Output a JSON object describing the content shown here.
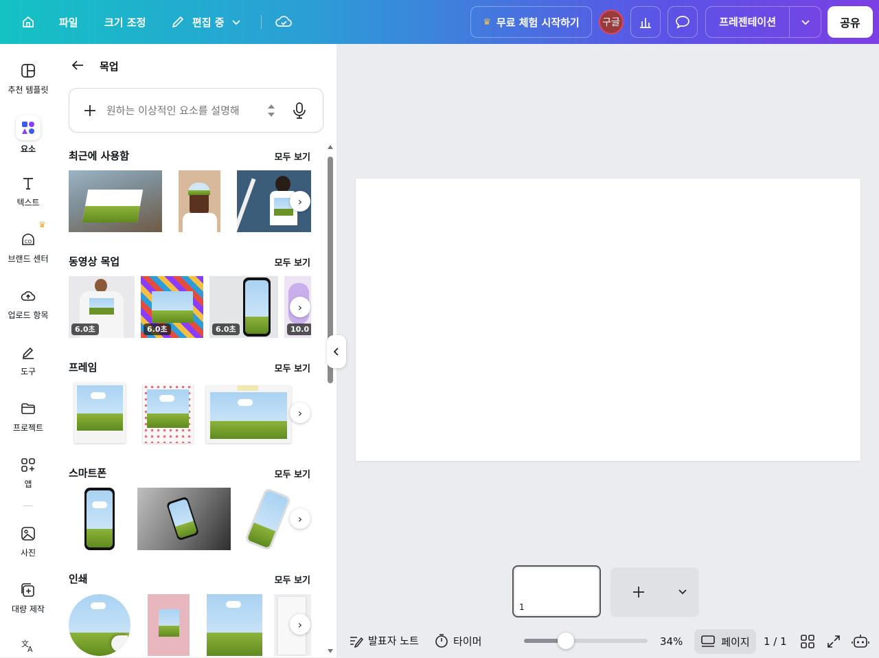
{
  "topbar": {
    "file": "파일",
    "resize": "크기 조정",
    "editing": "편집 중",
    "trial": "무료 체험 시작하기",
    "avatar": "구글",
    "presentation": "프레젠테이션",
    "share": "공유"
  },
  "rail": {
    "items": [
      {
        "label": "추천 템플릿"
      },
      {
        "label": "요소"
      },
      {
        "label": "텍스트"
      },
      {
        "label": "브랜드 센터"
      },
      {
        "label": "업로드 항목"
      },
      {
        "label": "도구"
      },
      {
        "label": "프로젝트"
      },
      {
        "label": "앱"
      },
      {
        "label": "사진"
      },
      {
        "label": "대량 제작"
      }
    ]
  },
  "panel": {
    "title": "목업",
    "search_placeholder": "원하는 이상적인 요소를 설명해",
    "see_all": "모두 보기",
    "sections": [
      {
        "title": "최근에 사용함"
      },
      {
        "title": "동영상 목업",
        "badges": [
          "6.0초",
          "6.0초",
          "6.0초",
          "10.0"
        ]
      },
      {
        "title": "프레임"
      },
      {
        "title": "스마트폰"
      },
      {
        "title": "인쇄"
      }
    ]
  },
  "pages": {
    "thumb_number": "1"
  },
  "bottombar": {
    "notes": "발표자 노트",
    "timer": "타이머",
    "zoom": "34%",
    "zoom_level": 0.34,
    "pages": "페이지",
    "page_count": "1 / 1"
  },
  "colors": {
    "accent": "#8b3dff",
    "topbar_start": "#14c2c4",
    "topbar_end": "#7b3fe4"
  }
}
